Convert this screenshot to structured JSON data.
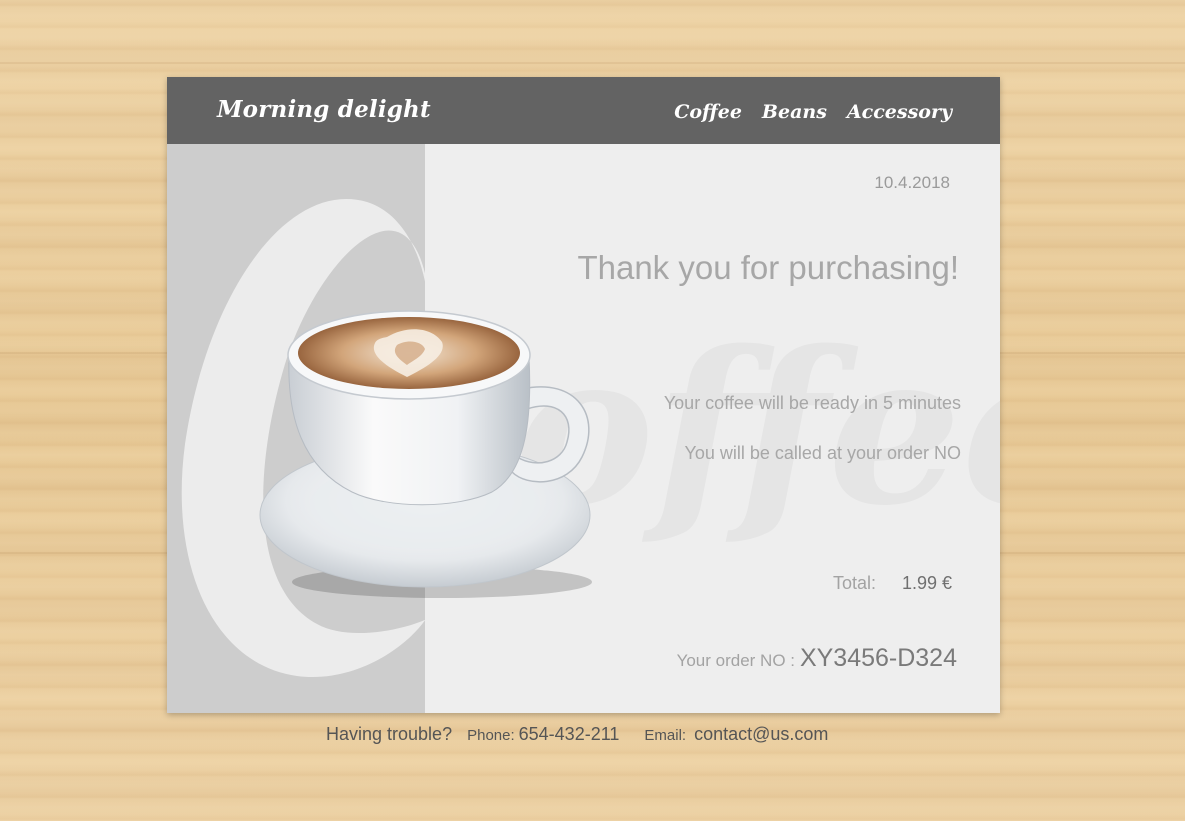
{
  "header": {
    "brand": "Morning delight",
    "nav": [
      {
        "label": "Coffee"
      },
      {
        "label": "Beans"
      },
      {
        "label": "Accessory"
      }
    ]
  },
  "receipt": {
    "date": "10.4.2018",
    "headline": "Thank you for purchasing!",
    "message_ready": "Your coffee will be ready in 5 minutes",
    "message_called": "You will be called at your order NO",
    "total_label": "Total:",
    "total_value": "1.99 €",
    "order_label": "Your order NO :",
    "order_value": "XY3456-D324"
  },
  "footer": {
    "trouble": "Having trouble?",
    "phone_label": "Phone:",
    "phone_value": "654-432-211",
    "email_label": "Email:",
    "email_value": "contact@us.com"
  },
  "decor": {
    "watermark_text": "Coffee",
    "images": [
      "coffee-cup-image"
    ]
  },
  "colors": {
    "navbar": "#636363",
    "card": "#eeeeee",
    "left_panel": "#cdcdcd",
    "muted_text": "#a7a7a7"
  }
}
